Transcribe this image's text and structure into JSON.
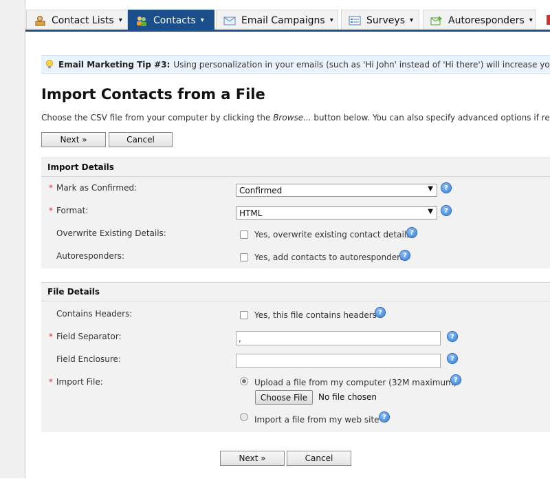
{
  "nav": {
    "tabs": [
      {
        "label": "Contact Lists",
        "icon": "contact-lists-icon",
        "active": false
      },
      {
        "label": "Contacts",
        "icon": "contacts-icon",
        "active": true
      },
      {
        "label": "Email Campaigns",
        "icon": "email-icon",
        "active": false
      },
      {
        "label": "Surveys",
        "icon": "surveys-icon",
        "active": false
      },
      {
        "label": "Autoresponders",
        "icon": "autoresponders-icon",
        "active": false
      }
    ],
    "caret": "▾",
    "accent_color": "#1b4f8b"
  },
  "tip": {
    "title": "Email Marketing Tip #3:",
    "text": "Using personalization in your emails (such as 'Hi John' instead of 'Hi there') will increase your ope"
  },
  "page": {
    "title": "Import Contacts from a File",
    "intro_before": "Choose the CSV file from your computer by clicking the ",
    "intro_em": "Browse...",
    "intro_after": " button below. You can also specify advanced options if required."
  },
  "buttons": {
    "next": "Next »",
    "cancel": "Cancel"
  },
  "import_details": {
    "heading": "Import Details",
    "mark_confirmed": {
      "label": "Mark as Confirmed:",
      "value": "Confirmed"
    },
    "format": {
      "label": "Format:",
      "value": "HTML"
    },
    "overwrite": {
      "label": "Overwrite Existing Details:",
      "option": "Yes, overwrite existing contact details"
    },
    "autoresponders": {
      "label": "Autoresponders:",
      "option": "Yes, add contacts to autoresponders"
    }
  },
  "file_details": {
    "heading": "File Details",
    "contains_headers": {
      "label": "Contains Headers:",
      "option": "Yes, this file contains headers"
    },
    "field_separator": {
      "label": "Field Separator:",
      "value": ","
    },
    "field_enclosure": {
      "label": "Field Enclosure:",
      "value": ""
    },
    "import_file": {
      "label": "Import File:",
      "upload_option": "Upload a file from my computer (32M maximum)",
      "choose_file": "Choose File",
      "no_file": "No file chosen",
      "website_option": "Import a file from my web site"
    }
  },
  "required_marker": "*",
  "help_glyph": "?"
}
